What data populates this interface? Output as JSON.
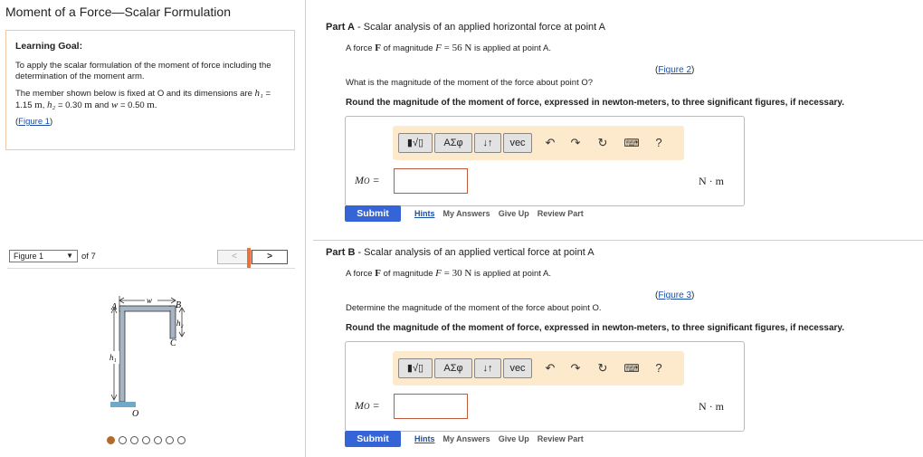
{
  "app": {
    "title": "Moment of a Force—Scalar Formulation"
  },
  "goal": {
    "title": "Learning Goal:",
    "text1": "To apply the scalar formulation of the moment of force including the determination of the moment arm.",
    "text2a": "The member shown below is fixed at O and its dimensions are ",
    "h1_var": "h₁",
    "h1_val": " = 1.15 ",
    "unit_m": "m",
    "h2_var": "h₂",
    "h2_val": " = 0.30 ",
    "w_var": "w",
    "w_val": " = 0.50 ",
    "and": " and ",
    "comma": ", ",
    "period": ".",
    "figure_link": "Figure 1",
    "paren_open": "(",
    "paren_close": ")"
  },
  "figure": {
    "selected": "Figure 1",
    "of_label": "of 7",
    "prev": "<",
    "next": ">",
    "labels": {
      "A": "A",
      "B": "B",
      "C": "C",
      "O": "O",
      "w": "w",
      "h1": "h₁",
      "h2": "h₂"
    },
    "dots_total": 7,
    "dots_active": 1
  },
  "partA": {
    "title_part": "Part A",
    "title_rest": " - Scalar analysis of an applied horizontal force at point A",
    "statement_a": "A force ",
    "F_bold": "F",
    "statement_b": " of magnitude ",
    "F_var": "F",
    "eq": " = 56 ",
    "N": "N",
    "statement_c": " is applied at point A.",
    "figure_link": "Figure 2",
    "question": "What is the magnitude of the moment of the force about point O?",
    "round": "Round the magnitude of the moment of force, expressed in newton-meters, to three significant figures, if necessary.",
    "mo_label": "M",
    "mo_sub": "O",
    "mo_eq": " =",
    "unit": "N · m",
    "submit": "Submit"
  },
  "partB": {
    "title_part": "Part B",
    "title_rest": " - Scalar analysis of an applied vertical force at point A",
    "statement_a": "A force ",
    "F_bold": "F",
    "statement_b": " of magnitude ",
    "F_var": "F",
    "eq": " = 30 ",
    "N": "N",
    "statement_c": " is applied at point A.",
    "figure_link": "Figure 3",
    "question": "Determine the magnitude of the moment of the force about point O.",
    "round": "Round the magnitude of the moment of force, expressed in newton-meters, to three significant figures, if necessary.",
    "mo_label": "M",
    "mo_sub": "O",
    "mo_eq": " =",
    "unit": "N · m",
    "submit": "Submit"
  },
  "toolbar": {
    "template": "▮√▯",
    "greek": "ΑΣφ",
    "arrows": "↓↑",
    "vec": "vec",
    "help": "?"
  },
  "actions": {
    "hints": "Hints",
    "my_answers": "My Answers",
    "give_up": "Give Up",
    "review_part": "Review Part"
  },
  "colors": {
    "accent_orange": "#e8733a",
    "toolbar_bg": "#fde9cc",
    "submit_blue": "#3564d6",
    "link_blue": "#1a4fa8",
    "input_border": "#c05a3c"
  }
}
